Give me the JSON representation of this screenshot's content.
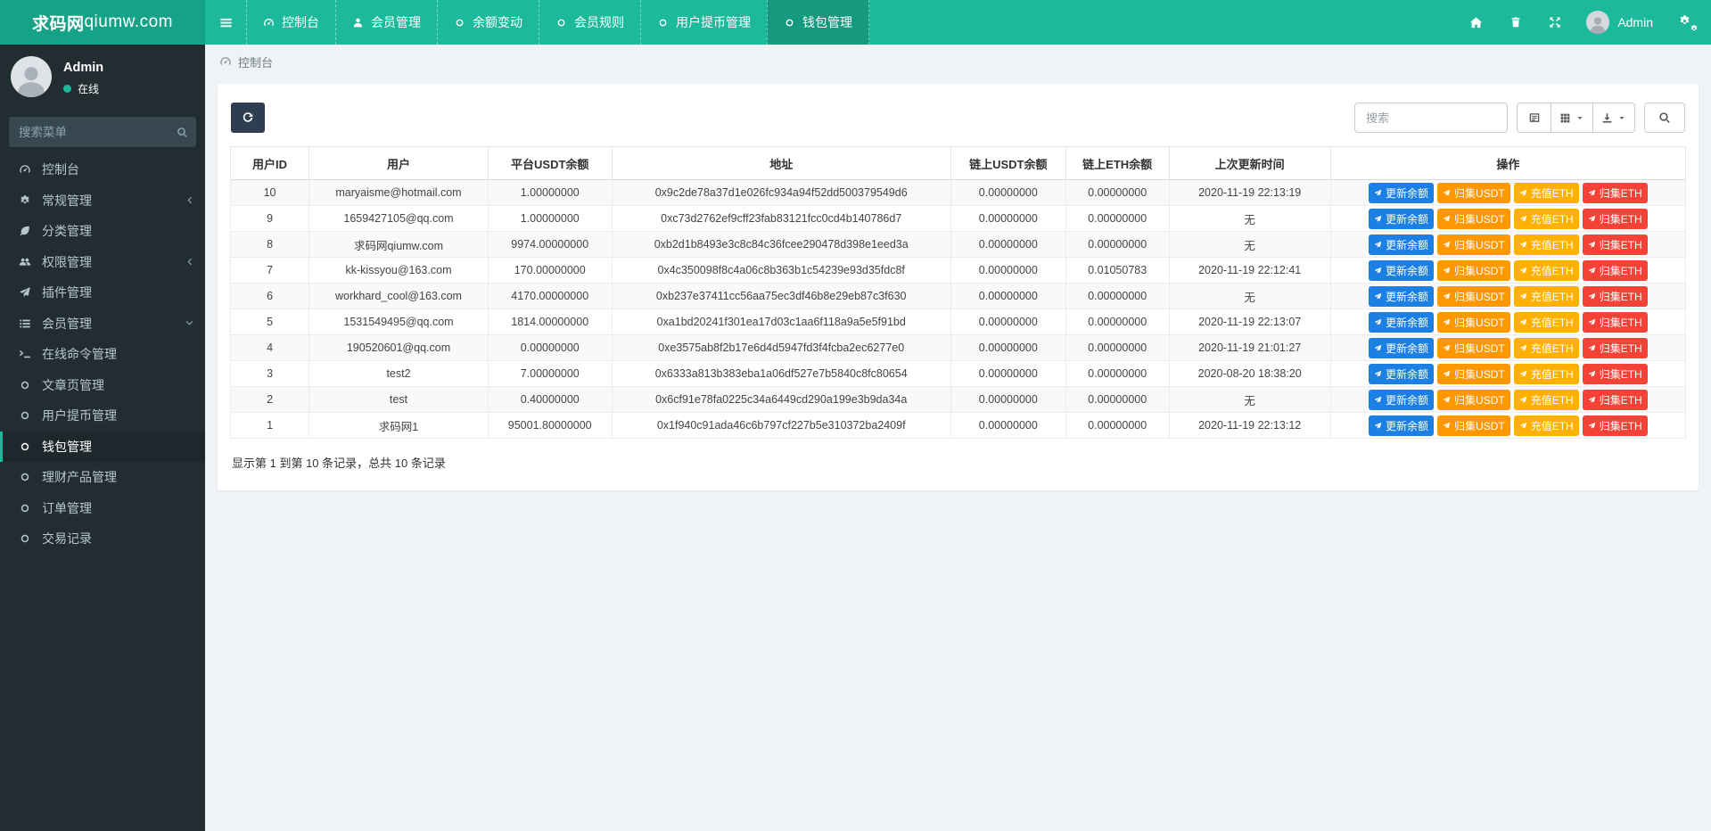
{
  "brand": {
    "bold": "求码网",
    "rest": "qiumw.com"
  },
  "navbar": {
    "items": [
      {
        "label": "控制台",
        "icon": "tachometer-icon",
        "active": false
      },
      {
        "label": "会员管理",
        "icon": "user-icon",
        "active": false
      },
      {
        "label": "余额变动",
        "icon": "circle-icon",
        "active": false
      },
      {
        "label": "会员规则",
        "icon": "circle-icon",
        "active": false
      },
      {
        "label": "用户提币管理",
        "icon": "circle-icon",
        "active": false
      },
      {
        "label": "钱包管理",
        "icon": "circle-icon",
        "active": true
      }
    ],
    "user_name": "Admin"
  },
  "sidebar": {
    "user": {
      "name": "Admin",
      "status": "在线"
    },
    "search_placeholder": "搜索菜单",
    "items": [
      {
        "label": "控制台",
        "icon": "tachometer-icon",
        "active": false,
        "arrow": ""
      },
      {
        "label": "常规管理",
        "icon": "cogs-icon",
        "active": false,
        "arrow": "left"
      },
      {
        "label": "分类管理",
        "icon": "leaf-icon",
        "active": false,
        "arrow": ""
      },
      {
        "label": "权限管理",
        "icon": "users-icon",
        "active": false,
        "arrow": "left"
      },
      {
        "label": "插件管理",
        "icon": "paper-plane-icon",
        "active": false,
        "arrow": ""
      },
      {
        "label": "会员管理",
        "icon": "list-icon",
        "active": false,
        "arrow": "down"
      },
      {
        "label": "在线命令管理",
        "icon": "terminal-icon",
        "active": false,
        "arrow": ""
      },
      {
        "label": "文章页管理",
        "icon": "circle-icon",
        "active": false,
        "arrow": ""
      },
      {
        "label": "用户提币管理",
        "icon": "circle-icon",
        "active": false,
        "arrow": ""
      },
      {
        "label": "钱包管理",
        "icon": "circle-icon",
        "active": true,
        "arrow": ""
      },
      {
        "label": "理财产品管理",
        "icon": "circle-icon",
        "active": false,
        "arrow": ""
      },
      {
        "label": "订单管理",
        "icon": "circle-icon",
        "active": false,
        "arrow": ""
      },
      {
        "label": "交易记录",
        "icon": "circle-icon",
        "active": false,
        "arrow": ""
      }
    ]
  },
  "breadcrumb": {
    "label": "控制台"
  },
  "toolbar": {
    "search_placeholder": "搜索"
  },
  "colors": {
    "navbar": "#1cb99b",
    "btn_update": "#1b7fe3",
    "btn_collect_usdt": "#ff9800",
    "btn_recharge_eth": "#ffb000",
    "btn_collect_eth": "#f44336"
  },
  "table": {
    "columns": [
      "用户ID",
      "用户",
      "平台USDT余额",
      "地址",
      "链上USDT余额",
      "链上ETH余额",
      "上次更新时间",
      "操作"
    ],
    "action_buttons": [
      {
        "label": "更新余额",
        "color_key": "btn_update"
      },
      {
        "label": "归集USDT",
        "color_key": "btn_collect_usdt"
      },
      {
        "label": "充值ETH",
        "color_key": "btn_recharge_eth"
      },
      {
        "label": "归集ETH",
        "color_key": "btn_collect_eth"
      }
    ],
    "rows": [
      {
        "id": "10",
        "user": "maryaisme@hotmail.com",
        "balance": "1.00000000",
        "address": "0x9c2de78a37d1e026fc934a94f52dd500379549d6",
        "usdt": "0.00000000",
        "eth": "0.00000000",
        "updated": "2020-11-19 22:13:19"
      },
      {
        "id": "9",
        "user": "1659427105@qq.com",
        "balance": "1.00000000",
        "address": "0xc73d2762ef9cff23fab83121fcc0cd4b140786d7",
        "usdt": "0.00000000",
        "eth": "0.00000000",
        "updated": "无"
      },
      {
        "id": "8",
        "user": "求码网qiumw.com",
        "balance": "9974.00000000",
        "address": "0xb2d1b8493e3c8c84c36fcee290478d398e1eed3a",
        "usdt": "0.00000000",
        "eth": "0.00000000",
        "updated": "无"
      },
      {
        "id": "7",
        "user": "kk-kissyou@163.com",
        "balance": "170.00000000",
        "address": "0x4c350098f8c4a06c8b363b1c54239e93d35fdc8f",
        "usdt": "0.00000000",
        "eth": "0.01050783",
        "updated": "2020-11-19 22:12:41"
      },
      {
        "id": "6",
        "user": "workhard_cool@163.com",
        "balance": "4170.00000000",
        "address": "0xb237e37411cc56aa75ec3df46b8e29eb87c3f630",
        "usdt": "0.00000000",
        "eth": "0.00000000",
        "updated": "无"
      },
      {
        "id": "5",
        "user": "1531549495@qq.com",
        "balance": "1814.00000000",
        "address": "0xa1bd20241f301ea17d03c1aa6f118a9a5e5f91bd",
        "usdt": "0.00000000",
        "eth": "0.00000000",
        "updated": "2020-11-19 22:13:07"
      },
      {
        "id": "4",
        "user": "190520601@qq.com",
        "balance": "0.00000000",
        "address": "0xe3575ab8f2b17e6d4d5947fd3f4fcba2ec6277e0",
        "usdt": "0.00000000",
        "eth": "0.00000000",
        "updated": "2020-11-19 21:01:27"
      },
      {
        "id": "3",
        "user": "test2",
        "balance": "7.00000000",
        "address": "0x6333a813b383eba1a06df527e7b5840c8fc80654",
        "usdt": "0.00000000",
        "eth": "0.00000000",
        "updated": "2020-08-20 18:38:20"
      },
      {
        "id": "2",
        "user": "test",
        "balance": "0.40000000",
        "address": "0x6cf91e78fa0225c34a6449cd290a199e3b9da34a",
        "usdt": "0.00000000",
        "eth": "0.00000000",
        "updated": "无"
      },
      {
        "id": "1",
        "user": "求码网1",
        "balance": "95001.80000000",
        "address": "0x1f940c91ada46c6b797cf227b5e310372ba2409f",
        "usdt": "0.00000000",
        "eth": "0.00000000",
        "updated": "2020-11-19 22:13:12"
      }
    ],
    "summary": "显示第 1 到第 10 条记录，总共 10 条记录"
  }
}
